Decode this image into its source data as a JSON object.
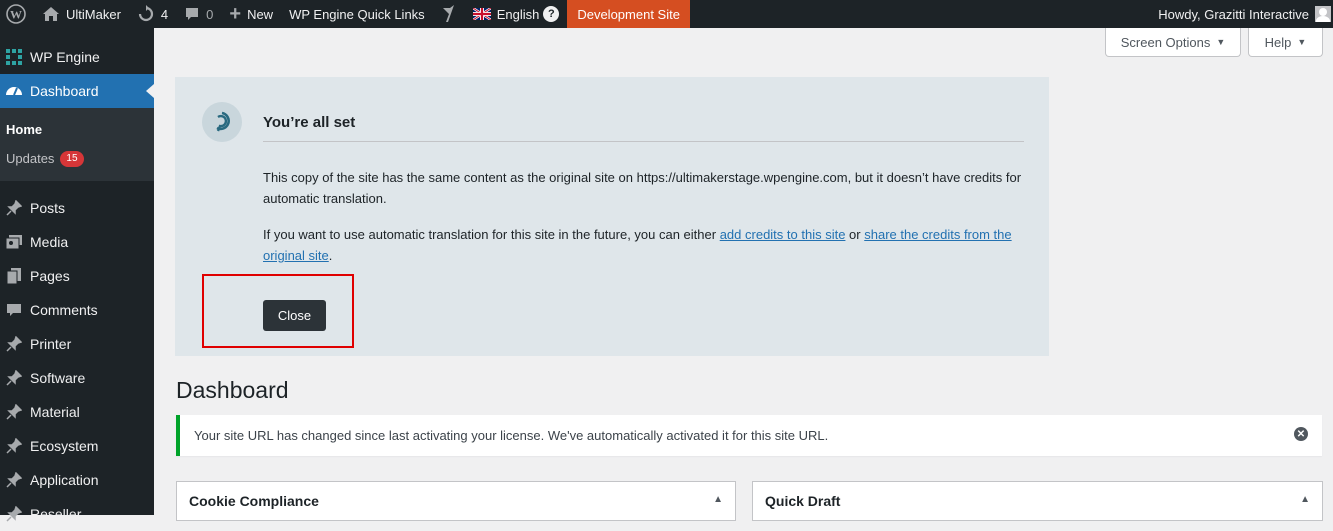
{
  "adminbar": {
    "site_name": "UltiMaker",
    "updates_count": "4",
    "comments_count": "0",
    "new_label": "New",
    "quick_links": "WP Engine Quick Links",
    "language": "English",
    "help_glyph": "?",
    "dev_site": "Development Site",
    "howdy": "Howdy, Grazitti Interactive"
  },
  "sidebar": {
    "items": [
      {
        "label": "WP Engine",
        "icon": "grid-icon"
      },
      {
        "label": "Dashboard",
        "icon": "dashboard-icon"
      },
      {
        "label": "Posts",
        "icon": "pin-icon"
      },
      {
        "label": "Media",
        "icon": "media-icon"
      },
      {
        "label": "Pages",
        "icon": "pages-icon"
      },
      {
        "label": "Comments",
        "icon": "comment-icon"
      },
      {
        "label": "Printer",
        "icon": "pin-icon"
      },
      {
        "label": "Software",
        "icon": "pin-icon"
      },
      {
        "label": "Material",
        "icon": "pin-icon"
      },
      {
        "label": "Ecosystem",
        "icon": "pin-icon"
      },
      {
        "label": "Application",
        "icon": "pin-icon"
      },
      {
        "label": "Reseller",
        "icon": "pin-icon"
      }
    ],
    "submenu": {
      "home": "Home",
      "updates": "Updates",
      "updates_badge": "15"
    }
  },
  "screen_options": {
    "screen_options_label": "Screen Options",
    "help_label": "Help"
  },
  "notice": {
    "title": "You’re all set",
    "paragraph1": "This copy of the site has the same content as the original site on https://ultimakerstage.wpengine.com, but it doesn’t have credits for automatic translation.",
    "paragraph2_prefix": "If you want to use automatic translation for this site in the future, you can either ",
    "link1": "add credits to this site",
    "paragraph2_middle": " or ",
    "link2": "share the credits from the original site",
    "paragraph2_suffix": ".",
    "close_label": "Close"
  },
  "main": {
    "page_title": "Dashboard",
    "license_notice": "Your site URL has changed since last activating your license. We've automatically activated it for this site URL."
  },
  "postboxes": [
    {
      "title": "Cookie Compliance"
    },
    {
      "title": "Quick Draft"
    }
  ],
  "colors": {
    "admin_bar": "#1d2327",
    "accent": "#2271b1",
    "dev_site": "#d54e21",
    "success": "#00a32a",
    "highlight_box": "#e00000"
  }
}
